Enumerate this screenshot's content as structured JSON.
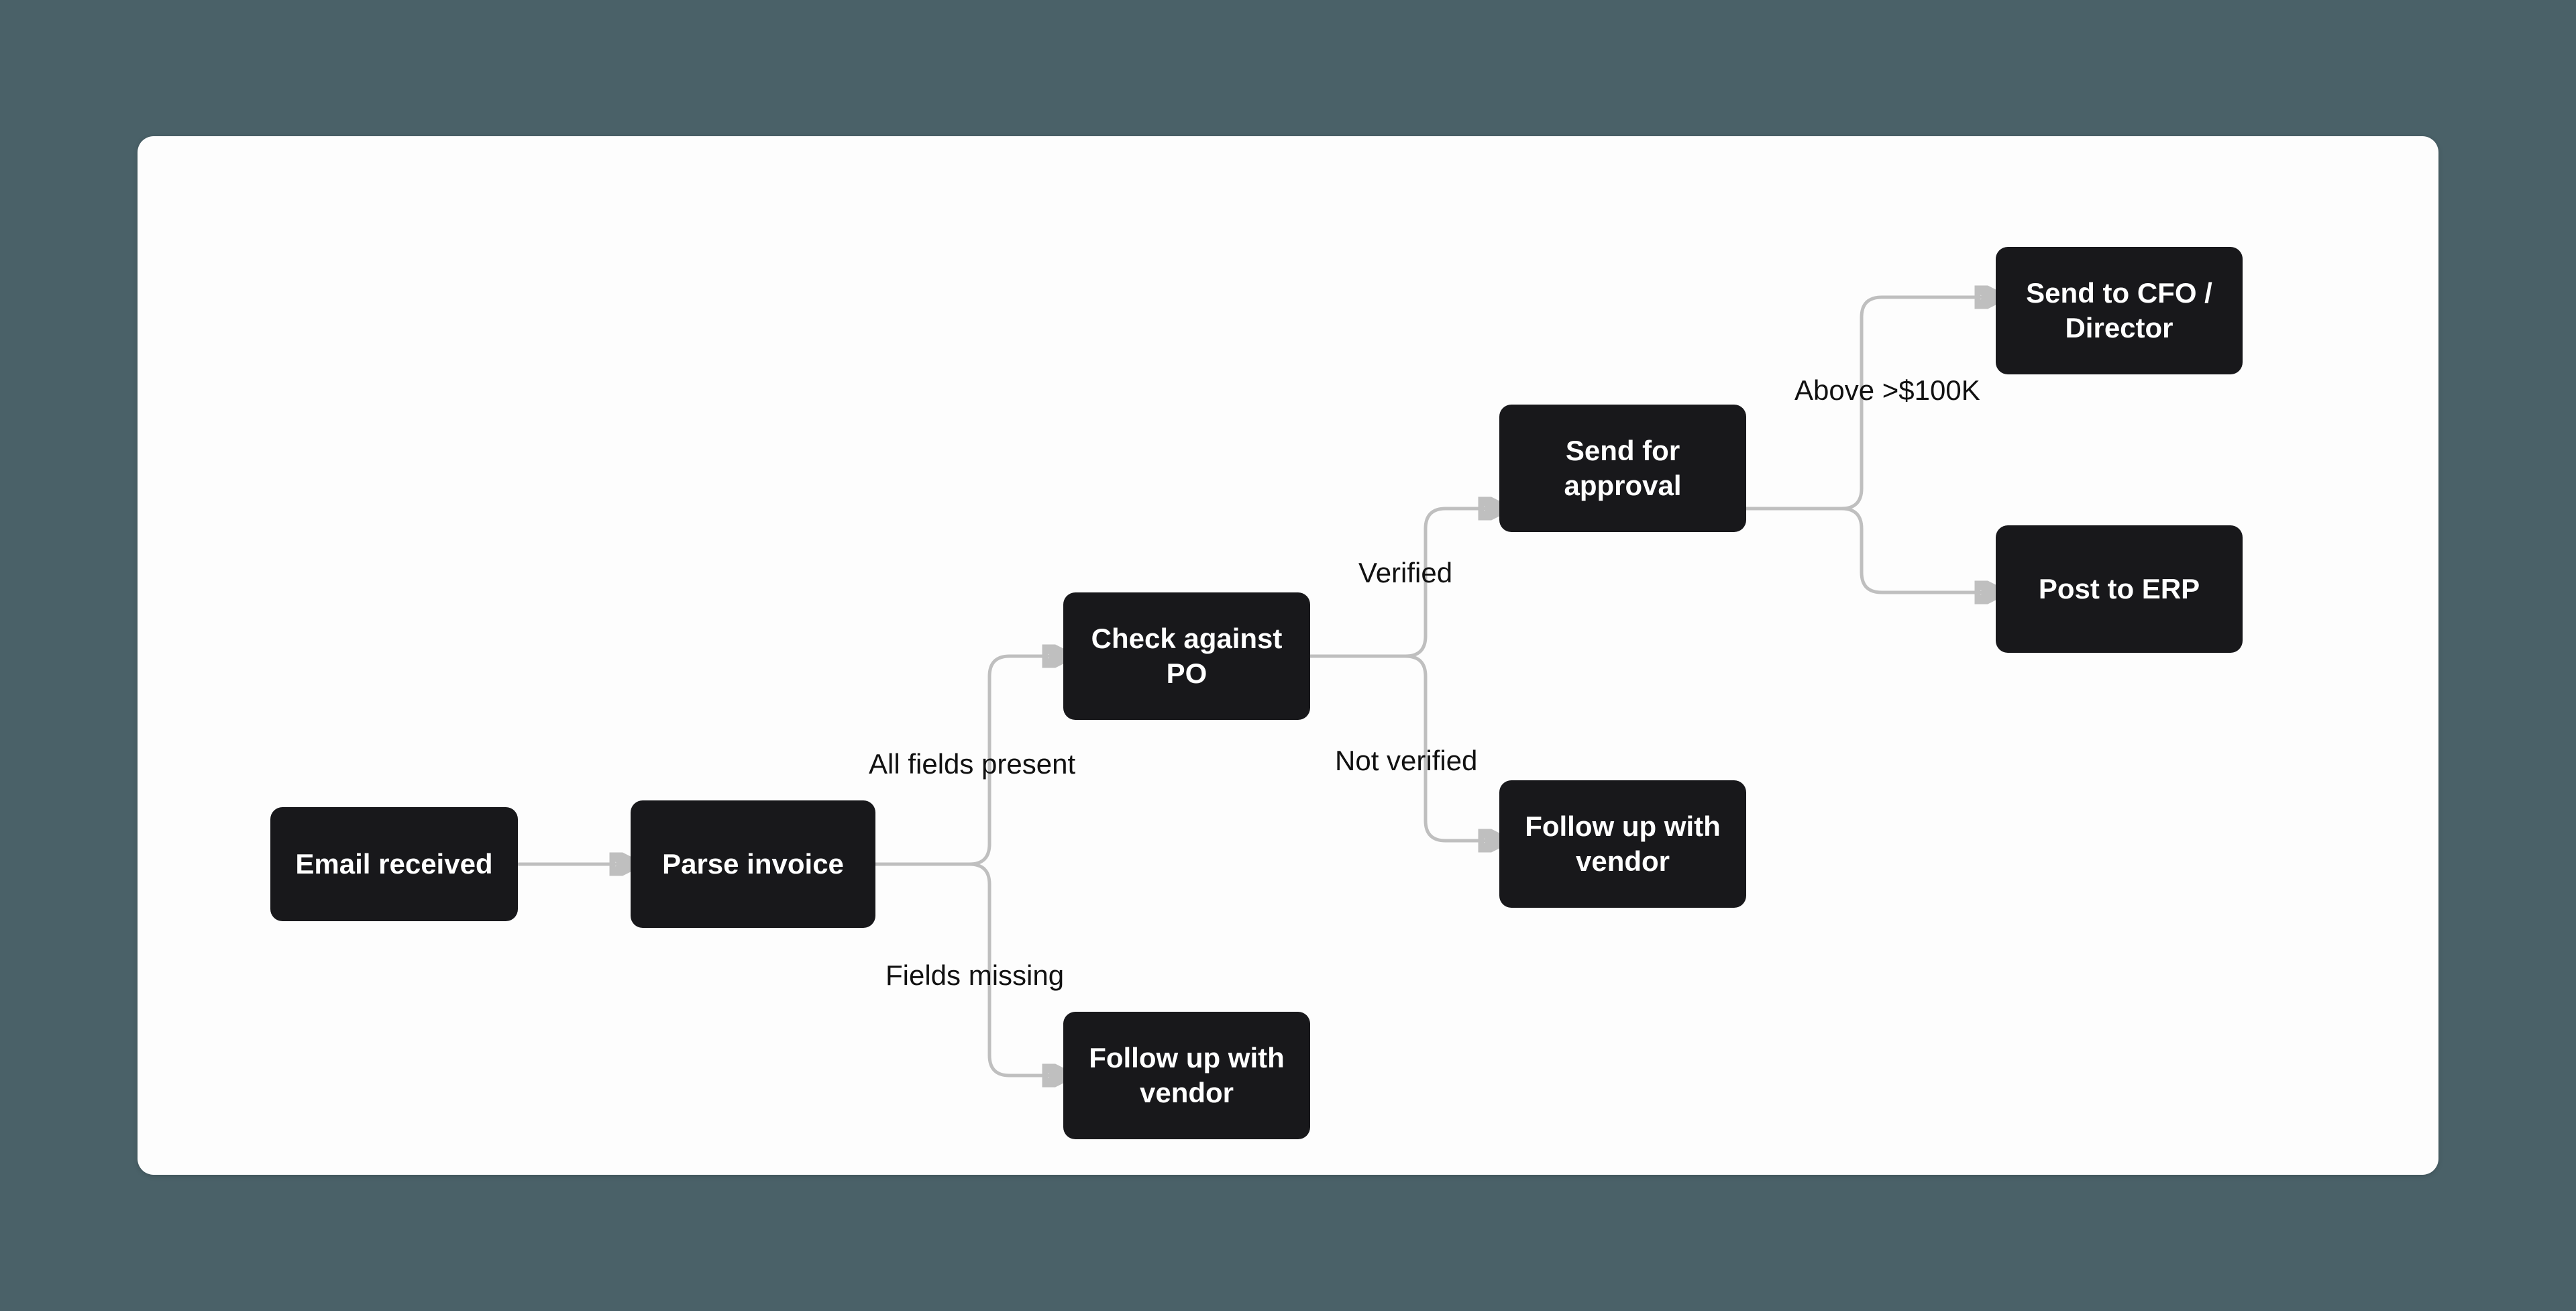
{
  "nodes": {
    "email_received": "Email received",
    "parse_invoice": "Parse invoice",
    "check_po": "Check against PO",
    "followup_vendor_1": "Follow up with vendor",
    "send_approval": "Send for approval",
    "followup_vendor_2": "Follow up with vendor",
    "send_cfo": "Send to CFO / Director",
    "post_erp": "Post to ERP"
  },
  "labels": {
    "all_fields": "All fields present",
    "fields_missing": "Fields missing",
    "verified": "Verified",
    "not_verified": "Not verified",
    "above_100k": "Above >$100K"
  }
}
